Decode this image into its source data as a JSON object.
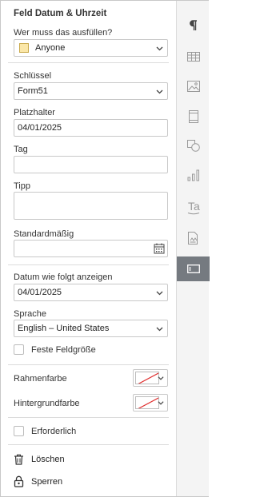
{
  "panel": {
    "title": "Feld Datum & Uhrzeit",
    "filler_label": "Wer muss das ausfüllen?",
    "filler_value": "Anyone",
    "filler_swatch_color": "#fbe7a8",
    "key_label": "Schlüssel",
    "key_value": "Form51",
    "placeholder_label": "Platzhalter",
    "placeholder_value": "04/01/2025",
    "tag_label": "Tag",
    "tag_value": "",
    "tip_label": "Tipp",
    "tip_value": "",
    "default_label": "Standardmäßig",
    "default_value": "",
    "display_label": "Datum wie folgt anzeigen",
    "display_value": "04/01/2025",
    "language_label": "Sprache",
    "language_value": "English – United States",
    "fixed_size_label": "Feste Feldgröße",
    "border_color_label": "Rahmenfarbe",
    "background_color_label": "Hintergrundfarbe",
    "required_label": "Erforderlich",
    "delete_label": "Löschen",
    "lock_label": "Sperren"
  },
  "rail": {
    "items": [
      {
        "icon": "paragraph-icon"
      },
      {
        "icon": "table-icon"
      },
      {
        "icon": "image-icon"
      },
      {
        "icon": "header-footer-icon"
      },
      {
        "icon": "shapes-icon"
      },
      {
        "icon": "chart-icon"
      },
      {
        "icon": "text-art-icon"
      },
      {
        "icon": "signature-icon"
      },
      {
        "icon": "form-field-icon",
        "active": true
      }
    ]
  },
  "colors": {
    "active_rail": "#757a80",
    "no_color_line": "#e03030"
  }
}
